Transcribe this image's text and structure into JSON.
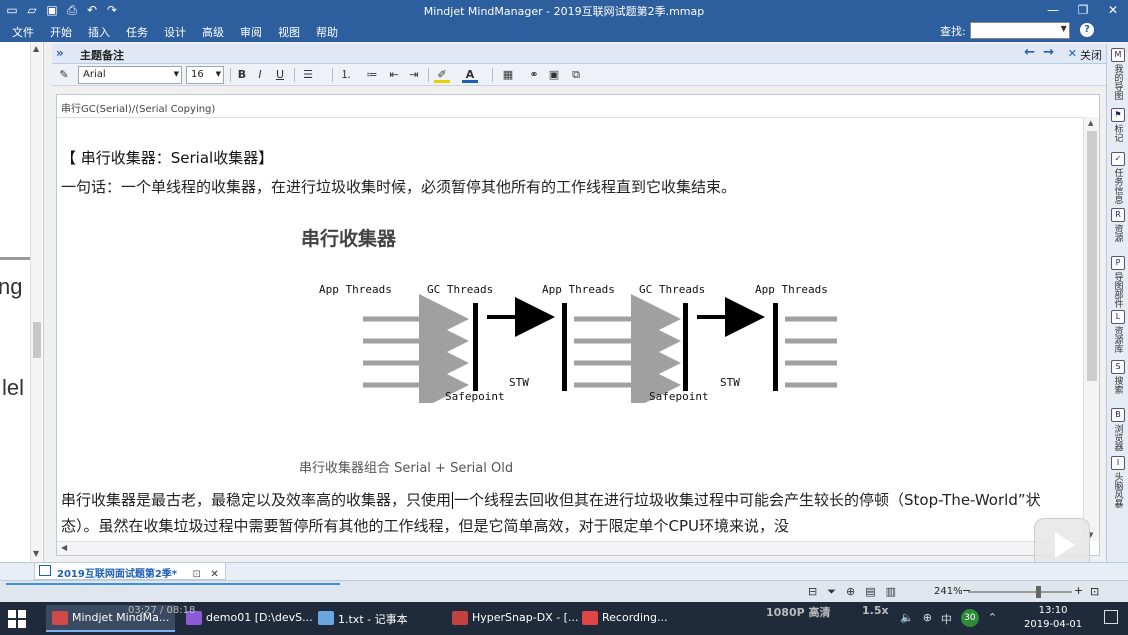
{
  "window": {
    "title": "Mindjet MindManager - 2019互联网试题第2季.mmap",
    "min": "—",
    "restore": "❐",
    "close": "✕"
  },
  "menu": {
    "items": [
      "文件",
      "开始",
      "插入",
      "任务",
      "设计",
      "高级",
      "审阅",
      "视图",
      "帮助"
    ],
    "search_label": "查找:",
    "help": "?"
  },
  "left_canvas": {
    "frag1": "ng",
    "frag2": "lel"
  },
  "notes_panel": {
    "collapse": "»",
    "title": "主题备注",
    "back": "←",
    "forward": "→",
    "close_x": "✕",
    "close_label": "关闭"
  },
  "format_bar": {
    "font": "Arial",
    "size": "16",
    "bold": "B",
    "italic": "I",
    "underline": "U"
  },
  "doc": {
    "breadcrumb": "串行GC(Serial)/(Serial Copying)",
    "heading": "【 串行收集器：Serial收集器】",
    "para1": "一句话：一个单线程的收集器，在进行垃圾收集时候，必须暂停其他所有的工作线程直到它收集结束。",
    "para2_a": "串行收集器是最古老，最稳定以及效率高的收集器，只使用",
    "para2_b": "一个线程去回收但其在进行垃圾收集过程中可能会产生较长的停顿（Stop-The-World”状态）。虽然在收集垃圾过程中需要暂停所有其他的工作线程，但是它简单高效，对于限定单个CPU环境来说，没"
  },
  "diagram": {
    "title": "串行收集器",
    "labels": [
      "App Threads",
      "GC Threads",
      "App Threads",
      "GC Threads",
      "App Threads"
    ],
    "stw": "STW",
    "safepoint": "Safepoint",
    "caption": "串行收集器组合 Serial + Serial Old"
  },
  "right_sidebar": [
    {
      "label": "我的导图",
      "icon": "M"
    },
    {
      "label": "标记",
      "icon": "⚑"
    },
    {
      "label": "任务信息",
      "icon": "✓"
    },
    {
      "label": "资源",
      "icon": "R"
    },
    {
      "label": "导图部件",
      "icon": "P"
    },
    {
      "label": "资源库",
      "icon": "L"
    },
    {
      "label": "搜索",
      "icon": "S"
    },
    {
      "label": "浏览器",
      "icon": "B"
    },
    {
      "label": "头脑风暴",
      "icon": "I"
    }
  ],
  "tab": {
    "label": "2019互联网面试题第2季*",
    "pin": "⊡",
    "close": "✕"
  },
  "status": {
    "zoom": "241%",
    "minus": "−",
    "plus": "+"
  },
  "taskbar": {
    "tasks": [
      {
        "label": "Mindjet MindMa...",
        "color": "#d04a4a"
      },
      {
        "label": "demo01 [D:\\devS...",
        "color": "#8a5ad8"
      },
      {
        "label": "1.txt - 记事本",
        "color": "#6aa7de"
      },
      {
        "label": "HyperSnap-DX - [...",
        "color": "#c24141"
      },
      {
        "label": "Recording...",
        "color": "#e04545"
      }
    ],
    "overlay_time": "03:27 / 08:18",
    "quality": "1080P 高清",
    "speed": "1.5x",
    "ime": "中",
    "badge": "30",
    "time": "13:10",
    "date": "2019-04-01"
  }
}
